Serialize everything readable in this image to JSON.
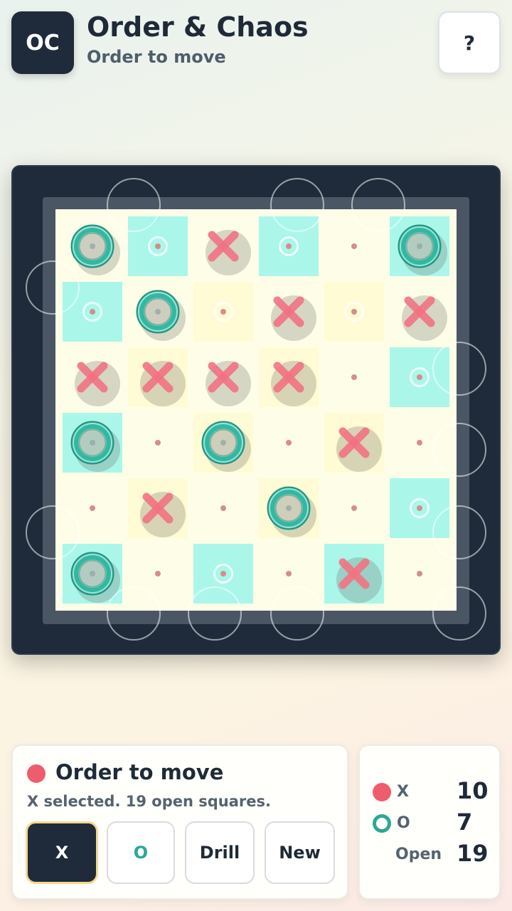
{
  "header": {
    "logo_text": "OC",
    "title": "Order & Chaos",
    "subtitle": "Order to move",
    "help_label": "?"
  },
  "board": {
    "size": 6,
    "cells": [
      [
        {
          "p": "O",
          "t": "blank"
        },
        {
          "p": "",
          "t": "cyan"
        },
        {
          "p": "X",
          "t": "blank"
        },
        {
          "p": "",
          "t": "cyan"
        },
        {
          "p": "",
          "t": "blank"
        },
        {
          "p": "O",
          "t": "cyan"
        }
      ],
      [
        {
          "p": "",
          "t": "cyan"
        },
        {
          "p": "O",
          "t": "blank"
        },
        {
          "p": "",
          "t": "yellow"
        },
        {
          "p": "X",
          "t": "blank"
        },
        {
          "p": "",
          "t": "yellow"
        },
        {
          "p": "X",
          "t": "blank"
        }
      ],
      [
        {
          "p": "X",
          "t": "blank"
        },
        {
          "p": "X",
          "t": "yellow"
        },
        {
          "p": "X",
          "t": "blank"
        },
        {
          "p": "X",
          "t": "yellow"
        },
        {
          "p": "",
          "t": "blank"
        },
        {
          "p": "",
          "t": "cyan"
        }
      ],
      [
        {
          "p": "O",
          "t": "cyan"
        },
        {
          "p": "",
          "t": "blank"
        },
        {
          "p": "O",
          "t": "yellow"
        },
        {
          "p": "",
          "t": "blank"
        },
        {
          "p": "X",
          "t": "yellow"
        },
        {
          "p": "",
          "t": "blank"
        }
      ],
      [
        {
          "p": "",
          "t": "blank"
        },
        {
          "p": "X",
          "t": "yellow"
        },
        {
          "p": "",
          "t": "blank"
        },
        {
          "p": "O",
          "t": "yellow"
        },
        {
          "p": "",
          "t": "blank"
        },
        {
          "p": "",
          "t": "cyan"
        }
      ],
      [
        {
          "p": "O",
          "t": "cyan"
        },
        {
          "p": "",
          "t": "blank"
        },
        {
          "p": "",
          "t": "cyan"
        },
        {
          "p": "",
          "t": "blank"
        },
        {
          "p": "X",
          "t": "cyan"
        },
        {
          "p": "",
          "t": "blank"
        }
      ]
    ]
  },
  "status": {
    "title": "Order to move",
    "message": "X selected. 19 open squares.",
    "buttons": {
      "x": "X",
      "o": "O",
      "drill": "Drill",
      "new": "New"
    },
    "selected": "X"
  },
  "scores": {
    "x_label": "X",
    "x_value": "10",
    "o_label": "O",
    "o_value": "7",
    "open_label": "Open",
    "open_value": "19"
  },
  "colors": {
    "x_piece": "#f27383",
    "o_piece": "#2fb9a2",
    "board_dark": "#1f2b3a",
    "accent_selected": "#f3d792"
  }
}
